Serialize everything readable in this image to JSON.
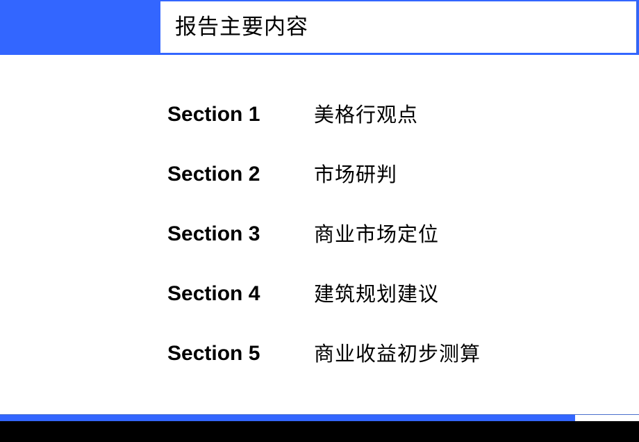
{
  "header": {
    "title": "报告主要内容"
  },
  "colors": {
    "accent_blue": "#3366ff",
    "footer_black": "#000000"
  },
  "sections": [
    {
      "label": "Section 1",
      "title": "美格行观点"
    },
    {
      "label": "Section 2",
      "title": "市场研判"
    },
    {
      "label": "Section 3",
      "title": "商业市场定位"
    },
    {
      "label": "Section 4",
      "title": "建筑规划建议"
    },
    {
      "label": "Section 5",
      "title": "商业收益初步测算"
    }
  ]
}
